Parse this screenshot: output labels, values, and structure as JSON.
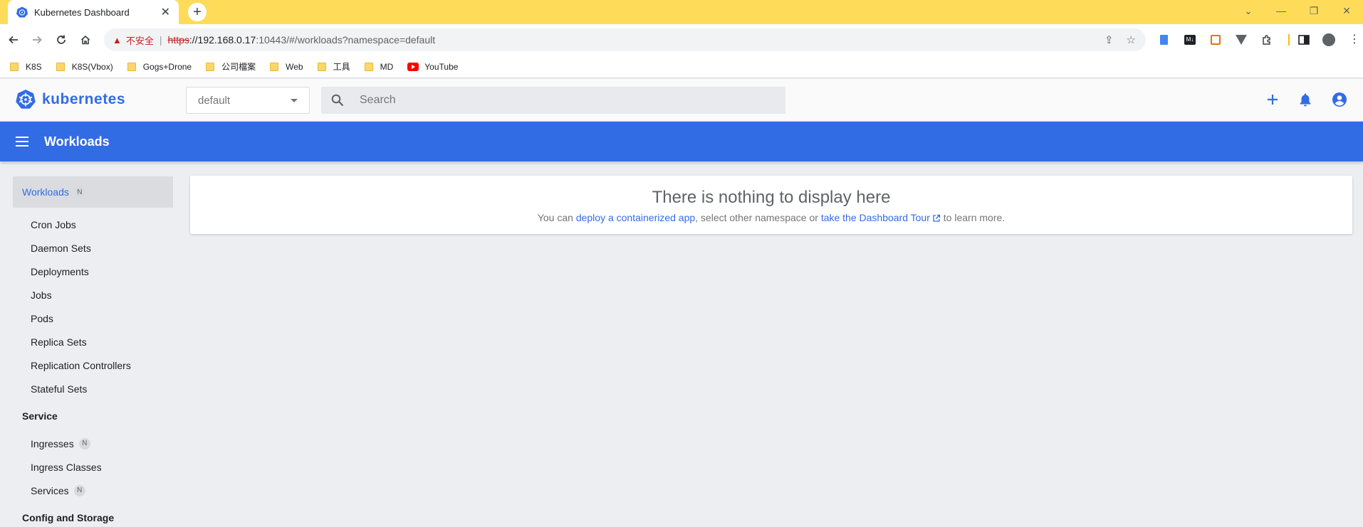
{
  "browser": {
    "tab_title": "Kubernetes Dashboard",
    "tab_close": "✕",
    "new_tab": "+",
    "address": {
      "insecure_label": "不安全",
      "scheme": "https",
      "host": "://192.168.0.17",
      "path": ":10443/#/workloads?namespace=default"
    },
    "bookmarks": [
      {
        "label": "K8S",
        "icon": "folder-icon"
      },
      {
        "label": "K8S(Vbox)",
        "icon": "folder-icon"
      },
      {
        "label": "Gogs+Drone",
        "icon": "folder-icon"
      },
      {
        "label": "公司檔案",
        "icon": "folder-icon"
      },
      {
        "label": "Web",
        "icon": "folder-icon"
      },
      {
        "label": "工具",
        "icon": "folder-icon"
      },
      {
        "label": "MD",
        "icon": "folder-icon"
      },
      {
        "label": "YouTube",
        "icon": "youtube-icon"
      }
    ],
    "colors": {
      "tabbar": "#fedc5a"
    }
  },
  "header": {
    "brand": "kubernetes",
    "namespace": "default",
    "search_placeholder": "Search"
  },
  "toolbar": {
    "title": "Workloads"
  },
  "sidebar": {
    "workloads_label": "Workloads",
    "workloads_badge": "N",
    "workload_items": [
      "Cron Jobs",
      "Daemon Sets",
      "Deployments",
      "Jobs",
      "Pods",
      "Replica Sets",
      "Replication Controllers",
      "Stateful Sets"
    ],
    "service_label": "Service",
    "service_items": [
      {
        "label": "Ingresses",
        "badge": "N"
      },
      {
        "label": "Ingress Classes",
        "badge": ""
      },
      {
        "label": "Services",
        "badge": "N"
      }
    ],
    "config_label": "Config and Storage"
  },
  "main": {
    "empty_title": "There is nothing to display here",
    "text_1": "You can ",
    "link_deploy": "deploy a containerized app",
    "text_2": ", select other namespace or ",
    "link_tour": "take the Dashboard Tour",
    "text_3": " to learn more."
  },
  "colors": {
    "primary": "#326ce5",
    "background": "#eceef1"
  }
}
